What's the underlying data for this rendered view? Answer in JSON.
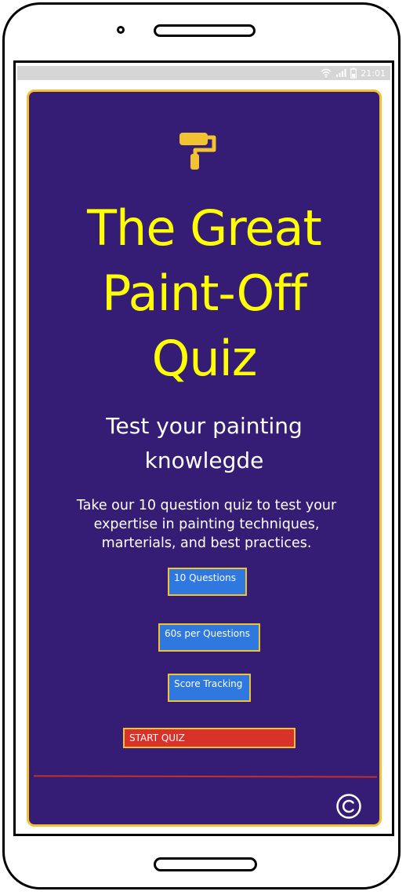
{
  "status_bar": {
    "time": "21:01",
    "icons": [
      "wifi-icon",
      "signal-icon",
      "battery-icon"
    ]
  },
  "app": {
    "logo_icon": "paint-roller-icon",
    "title_lines": [
      "The Great",
      "Paint-Off",
      "Quiz"
    ],
    "subtitle_lines": [
      "Test your painting",
      "knowlegde"
    ],
    "description": "Take our 10 question quiz to test your expertise in painting techniques, marterials, and best practices.",
    "features": [
      "10 Questions",
      "60s per Questions",
      "Score Tracking"
    ],
    "start_button": "START QUIZ",
    "footer_icon": "copyright-icon"
  },
  "colors": {
    "background": "#351c75",
    "border_accent": "#f1c232",
    "title": "#ffff00",
    "feature_button": "#2f78e0",
    "start_button": "#d9322a",
    "divider": "#c0332c"
  }
}
